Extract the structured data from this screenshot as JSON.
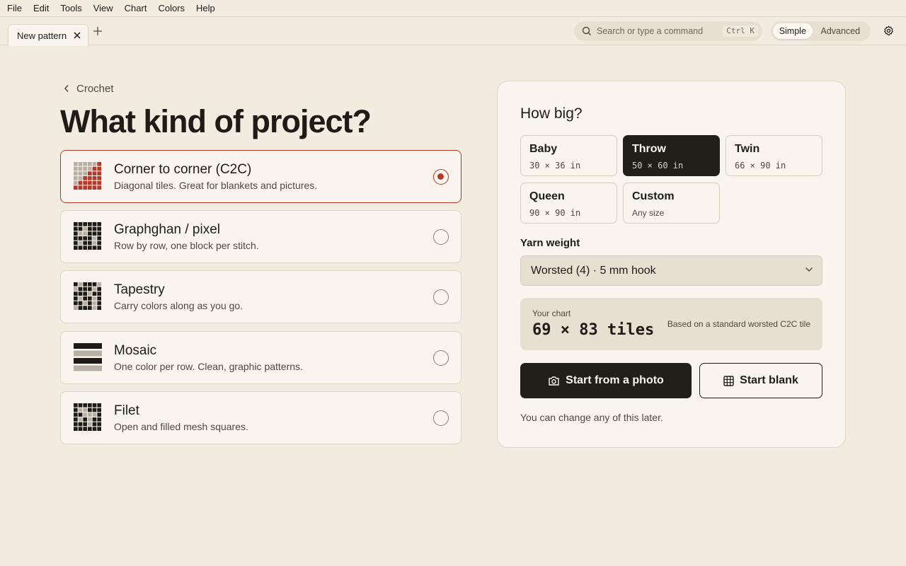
{
  "menu": [
    "File",
    "Edit",
    "Tools",
    "View",
    "Chart",
    "Colors",
    "Help"
  ],
  "tabs": [
    {
      "label": "New pattern"
    }
  ],
  "search": {
    "placeholder": "Search or type a command",
    "shortcut": "Ctrl K"
  },
  "mode": {
    "options": [
      "Simple",
      "Advanced"
    ],
    "selected": "Simple"
  },
  "back": {
    "label": "Crochet"
  },
  "title": "What kind of project?",
  "project_types": [
    {
      "title": "Corner to corner (C2C)",
      "desc": "Diagonal tiles. Great for blankets and pictures.",
      "selected": true,
      "icon": "c2c-grid-icon"
    },
    {
      "title": "Graphghan / pixel",
      "desc": "Row by row, one block per stitch.",
      "selected": false,
      "icon": "pixel-grid-icon"
    },
    {
      "title": "Tapestry",
      "desc": "Carry colors along as you go.",
      "selected": false,
      "icon": "tapestry-grid-icon"
    },
    {
      "title": "Mosaic",
      "desc": "One color per row. Clean, graphic patterns.",
      "selected": false,
      "icon": "mosaic-stripes-icon"
    },
    {
      "title": "Filet",
      "desc": "Open and filled mesh squares.",
      "selected": false,
      "icon": "filet-grid-icon"
    }
  ],
  "size_panel": {
    "title": "How big?",
    "sizes": [
      {
        "name": "Baby",
        "dims": "30 × 36 in",
        "active": false
      },
      {
        "name": "Throw",
        "dims": "50 × 60 in",
        "active": true
      },
      {
        "name": "Twin",
        "dims": "66 × 90 in",
        "active": false
      },
      {
        "name": "Queen",
        "dims": "90 × 90 in",
        "active": false
      },
      {
        "name": "Custom",
        "dims": "Any size",
        "active": false
      }
    ],
    "yarn_label": "Yarn weight",
    "yarn_value": "Worsted (4) · 5 mm hook",
    "summary_label": "Your chart",
    "summary_value": "69 × 83 tiles",
    "summary_note": "Based on a standard worsted C2C tile",
    "primary_button": "Start from a photo",
    "secondary_button": "Start blank",
    "footnote": "You can change any of this later."
  },
  "colors": {
    "accent": "#b33a2a",
    "dark": "#221e1a",
    "background": "#f2ebe0",
    "surface": "#f9f5ee"
  }
}
